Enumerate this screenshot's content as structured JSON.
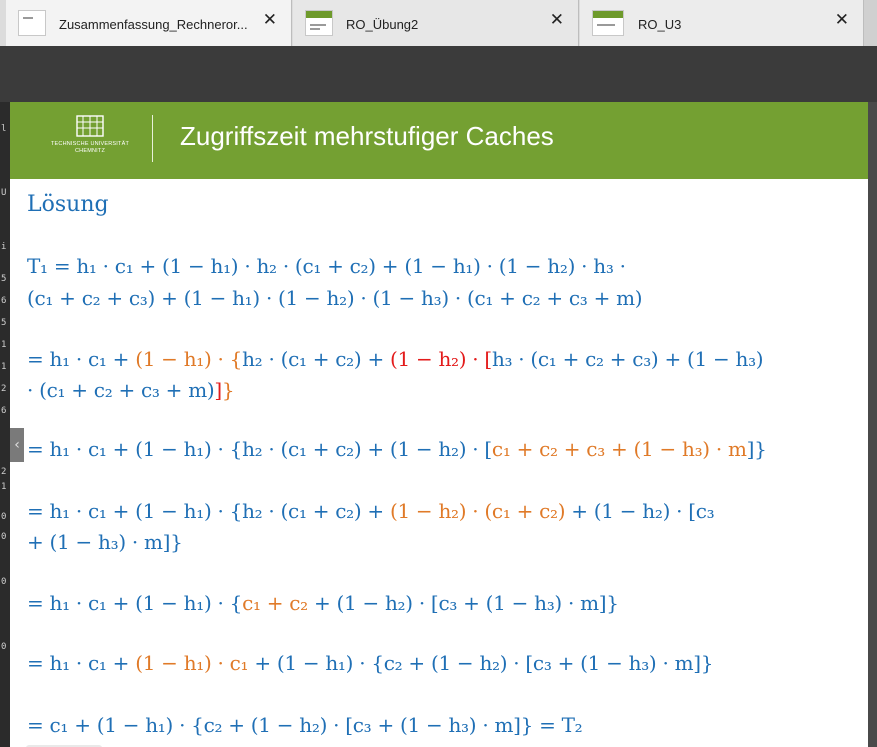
{
  "tabs": [
    {
      "title": "Zusammenfassung_Rechneror...",
      "close": "✕"
    },
    {
      "title": "RO_Übung2",
      "close": "✕"
    },
    {
      "title": "RO_U3",
      "close": "✕"
    }
  ],
  "left_strip_chars": [
    "l",
    "U",
    "i",
    "5",
    "6",
    "5",
    "1",
    "1",
    "2",
    "6",
    "2",
    "1",
    "0",
    "0",
    "0",
    "0"
  ],
  "collapse_handle": "‹",
  "slide": {
    "logo_text_1": "TECHNISCHE UNIVERSITÄT",
    "logo_text_2": "CHEMNITZ",
    "title": "Zugriffszeit mehrstufiger Caches",
    "heading": "Lösung"
  },
  "colors": {
    "header_green": "#74a032",
    "math_blue": "#1f6fb5",
    "math_orange": "#e07a28",
    "math_red": "#e31b1b"
  },
  "equations": {
    "l1a": "T₁ = h₁ · c₁ + (1 − h₁) · h₂ · (c₁ + c₂) + (1 − h₁) · (1 − h₂) · h₃ ·",
    "l1b": "(c₁ + c₂ + c₃) + (1 − h₁) · (1 − h₂) · (1 − h₃) · (c₁ + c₂ + c₃ + m)",
    "l2a_1": "= h₁ · c₁ + ",
    "l2a_2": "(1 − h₁) · {",
    "l2a_3": "h₂ · (c₁ + c₂) + ",
    "l2a_4": "(1 − h₂) · [",
    "l2a_5": "h₃ · (c₁ + c₂ + c₃) + (1 − h₃)",
    "l2b_1": "· (c₁ + c₂ + c₃ + m)",
    "l2b_2": "]",
    "l2b_3": "}",
    "l3_1": "= h₁ · c₁ + (1 − h₁) · {h₂ · (c₁ + c₂) + (1 − h₂) · [",
    "l3_2": "c₁ + c₂ + c₃ + (1 − h₃) · m",
    "l3_3": "]}",
    "l4a_1": "= h₁ · c₁ + (1 − h₁) · {h₂ · (c₁ + c₂) + ",
    "l4a_2": "(1 − h₂) · (c₁ + c₂)",
    "l4a_3": " + (1 − h₂) · [c₃",
    "l4b": "+ (1 − h₃) · m]}",
    "l5_1": "= h₁ · c₁ + (1 − h₁) · {",
    "l5_2": "c₁ + c₂",
    "l5_3": " + (1 − h₂) · [c₃ + (1 − h₃) · m]}",
    "l6_1": "= h₁ · c₁ + ",
    "l6_2": "(1 − h₁) · c₁",
    "l6_3": " + (1 − h₁) · {c₂ + (1 − h₂) · [c₃ + (1 − h₃) · m]}",
    "l7": "= c₁ + (1 − h₁) · {c₂ + (1 − h₂) · [c₃ + (1 − h₃) · m]} = T₂"
  }
}
